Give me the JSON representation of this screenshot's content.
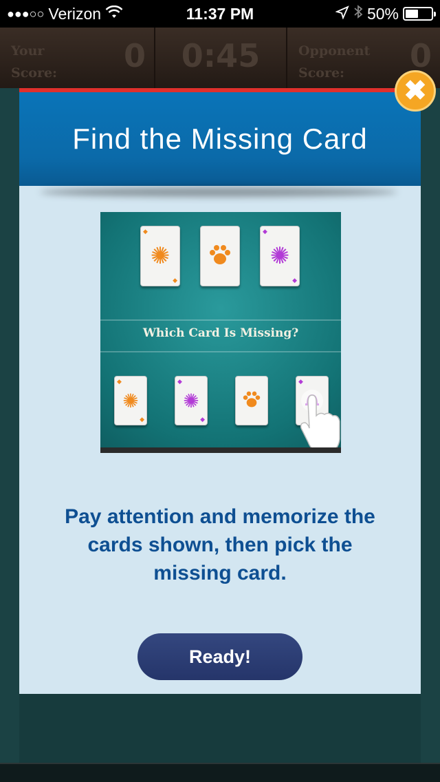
{
  "status_bar": {
    "signal": "●●●○○",
    "carrier": "Verizon",
    "time": "11:37 PM",
    "battery_percent": "50%",
    "battery_level": 0.5,
    "icons": [
      "wifi-icon",
      "location-icon",
      "bluetooth-icon",
      "battery-icon"
    ]
  },
  "scoreboard": {
    "your_score_label_line1": "Your",
    "your_score_label_line2": "Score:",
    "your_score": "0",
    "timer": "0:45",
    "opponent_label_line1": "Opponent",
    "opponent_label_line2": "Score:",
    "opponent_score": "0"
  },
  "modal": {
    "title": "Find the Missing Card",
    "close_icon": "close-icon",
    "illustration": {
      "question": "Which Card Is Missing?",
      "top_cards": [
        "orange-flower",
        "orange-paw",
        "purple-flower"
      ],
      "bottom_cards": [
        "orange-flower",
        "purple-flower",
        "orange-paw",
        "purple-bell"
      ]
    },
    "instructions": "Pay attention and memorize the cards shown, then pick the missing card.",
    "ready_label": "Ready!"
  },
  "colors": {
    "header_blue": "#0a74b8",
    "modal_bg": "#d3e6f1",
    "accent_red": "#e0302c",
    "close_orange": "#f5a623",
    "text_blue": "#0e4f92",
    "button_navy": "#2d3f77",
    "card_orange": "#f08a1e",
    "card_purple": "#b23bd6"
  }
}
